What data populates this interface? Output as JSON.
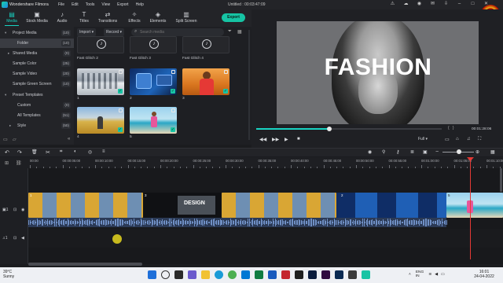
{
  "app": {
    "name": "Wondershare Filmora",
    "document": "Untitled : 00:03:47:09",
    "menus": [
      "File",
      "Edit",
      "Tools",
      "View",
      "Export",
      "Help"
    ]
  },
  "toolbar": {
    "tabs": [
      "Media",
      "Stock Media",
      "Audio",
      "Titles",
      "Transitions",
      "Effects",
      "Elements",
      "Split Screen"
    ],
    "export_label": "Export"
  },
  "tree": [
    {
      "label": "Project Media",
      "count": "(10)",
      "arrow": "▾"
    },
    {
      "label": "Folder",
      "count": "(10)",
      "selected": true
    },
    {
      "label": "Shared Media",
      "count": "(0)",
      "arrow": "▸"
    },
    {
      "label": "Sample Color",
      "count": "(25)"
    },
    {
      "label": "Sample Video",
      "count": "(20)"
    },
    {
      "label": "Sample Green Screen",
      "count": "(10)"
    },
    {
      "label": "Preset Templates",
      "count": "",
      "arrow": "▾"
    },
    {
      "label": "Custom",
      "count": "(0)"
    },
    {
      "label": "All Templates",
      "count": "(51)"
    },
    {
      "label": "Style",
      "count": "(50)",
      "arrow": "▸"
    }
  ],
  "media": {
    "import_label": "Import",
    "record_label": "Record",
    "search_placeholder": "Search media",
    "glitches": [
      "Fast Glitch 2",
      "Fast Glitch 3",
      "Fast Glitch 4"
    ],
    "items": [
      "1",
      "2",
      "3",
      "4",
      "5"
    ]
  },
  "preview": {
    "title": "FASHION",
    "time": "00:01:28:06",
    "quality": "Full"
  },
  "ruler": [
    "00:00",
    "00:00:05:00",
    "00:00:10:00",
    "00:00:15:00",
    "00:00:20:00",
    "00:00:25:00",
    "00:00:30:00",
    "00:00:35:00",
    "00:00:40:00",
    "00:00:45:00",
    "00:00:50:00",
    "00:00:55:00",
    "00:01:00:00",
    "00:01:05:00",
    "00:01:10:00"
  ],
  "timeline": {
    "design_text": "DESIGN",
    "clip_labels": [
      "1",
      "3",
      "2",
      "5"
    ]
  },
  "taskbar": {
    "temp": "39°C",
    "weather": "Sunny",
    "lang": "ENG",
    "region": "IN",
    "time": "16:01",
    "date": "24-04-2022"
  },
  "colors": {
    "accent": "#18d3c2",
    "export": "#16c4a4",
    "playhead": "#e53935"
  }
}
